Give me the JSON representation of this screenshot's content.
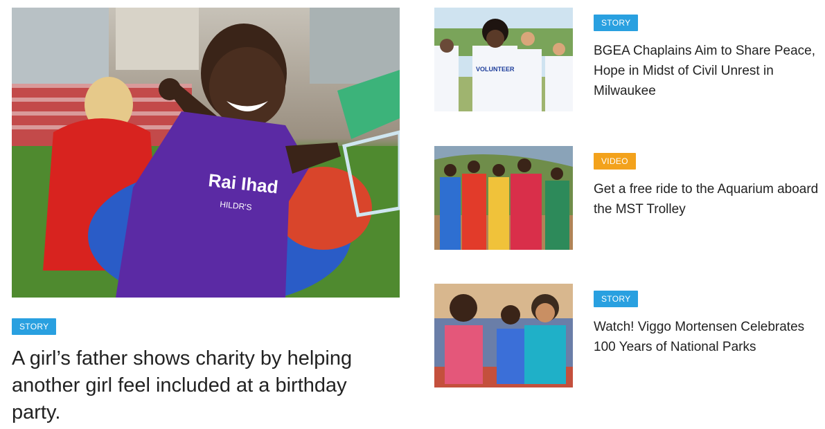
{
  "featured": {
    "tag": "STORY",
    "title": "A girl’s father shows charity by helping another girl feel included at a birthday party.",
    "shirt_text": "Rai Ihad",
    "shirt_subtext": "HILDR'S"
  },
  "items": [
    {
      "tag": "STORY",
      "title": "BGEA Chaplains Aim to Share Peace, Hope in Midst of Civil Unrest in Milwaukee",
      "shirt_text": "VOLUNTEER"
    },
    {
      "tag": "VIDEO",
      "title": "Get a free ride to the Aquarium aboard the MST Trolley"
    },
    {
      "tag": "STORY",
      "title": "Watch! Viggo Mortensen Celebrates 100 Years of National Parks"
    }
  ],
  "colors": {
    "story_tag": "#29a0e0",
    "video_tag": "#f3a21c",
    "title_text": "#222222"
  }
}
